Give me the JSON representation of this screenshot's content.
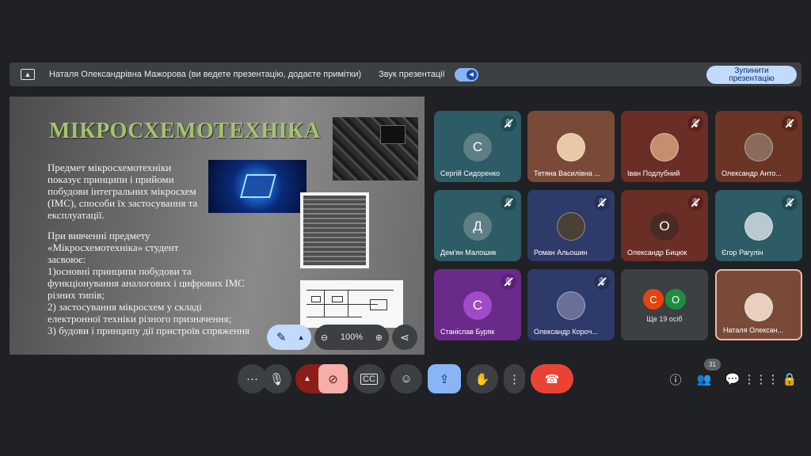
{
  "presenting_bar": {
    "presenter_text": "Наталя Олександрівна Мажорова (ви ведете презентацію, додаєте примітки)",
    "sound_label": "Звук презентації",
    "stop_button": "Зупинити презентацію"
  },
  "slide": {
    "title": "МІКРОСХЕМОТЕХНІКА",
    "paragraph1": "Предмет мікросхемотехніки показує принципи і прийоми побудови інтегральних мікросхем (ІМС), способи їх застосування та експлуатації.",
    "paragraph2_lines": [
      "При вивченні предмету",
      "«Мікросхемотехніка» студент",
      "засвоює:",
      " 1)основні принципи побудови та",
      " функціонування аналогових і цифрових ІМС",
      " різних типів;",
      " 2) застосування  мікросхем у складі",
      " електронної техніки різного призначення;",
      " 3) будови і принципу дії пристроїв спряження"
    ],
    "zoom": "100%"
  },
  "participants": [
    {
      "name": "Сергій Сидоренко",
      "initial": "С",
      "bg": "#2d5b66",
      "avatar_bg": "#5f7f86",
      "mic_bg": "#1f4a55",
      "photo": false
    },
    {
      "name": "Тетяна Василівна ...",
      "initial": "",
      "bg": "#7a4a38",
      "avatar_bg": "#e7c9a9",
      "mic_bg": "",
      "photo": true
    },
    {
      "name": "Іван Подлубний",
      "initial": "",
      "bg": "#6a2e26",
      "avatar_bg": "#c58f6e",
      "mic_bg": "#5a2019",
      "photo": true
    },
    {
      "name": "Олександр Анто...",
      "initial": "",
      "bg": "#6a3525",
      "avatar_bg": "#8a6a5a",
      "mic_bg": "#5a2515",
      "photo": true
    },
    {
      "name": "Дем'ян Малошик",
      "initial": "Д",
      "bg": "#2d5b66",
      "avatar_bg": "#5f7f86",
      "mic_bg": "#1f4a55",
      "photo": false
    },
    {
      "name": "Роман Альошин",
      "initial": "",
      "bg": "#2e3a6a",
      "avatar_bg": "#4a4036",
      "mic_bg": "#26305a",
      "photo": true
    },
    {
      "name": "Олександр Бицюк",
      "initial": "О",
      "bg": "#6a2e26",
      "avatar_bg": "#4a2a24",
      "mic_bg": "#5a2019",
      "photo": false
    },
    {
      "name": "Єгор Рагулін",
      "initial": "",
      "bg": "#2d5b66",
      "avatar_bg": "#b9c9cf",
      "mic_bg": "#1f4a55",
      "photo": true
    },
    {
      "name": "Станіслав Буряк",
      "initial": "С",
      "bg": "#6a2a8a",
      "avatar_bg": "#a24bc8",
      "mic_bg": "#5a1f78",
      "photo": false
    },
    {
      "name": "Олександр Корoч...",
      "initial": "",
      "bg": "#2e3a6a",
      "avatar_bg": "#6a6f9a",
      "mic_bg": "#26305a",
      "photo": true
    }
  ],
  "others": {
    "count_label": "Ще 19 осіб",
    "initials": [
      "С",
      "О"
    ],
    "colors": [
      "#e8430d",
      "#1e8e3e"
    ]
  },
  "self_tile": {
    "name": "Наталя Олексан...",
    "bg": "#7a4a38",
    "avatar_bg": "#e8cfc0"
  },
  "people_count": "31",
  "colors": {
    "end_call": "#ea4335",
    "accent": "#8ab4f8",
    "camera_off": "#f6aea9"
  }
}
